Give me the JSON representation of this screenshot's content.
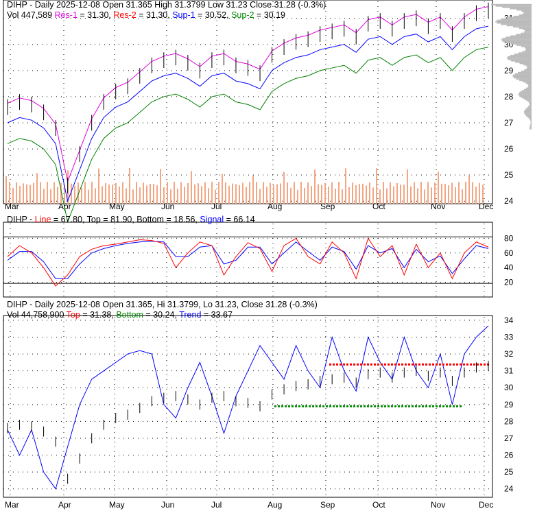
{
  "panel1": {
    "line1": "DIHP - Daily 2025-12-08 Open 31.365  High 31.3799  Low 31.23  Close 31.28 (-0.3%)",
    "vol": "Vol 447,589",
    "res1_label": "Res-1",
    "res1": "= 31.30,",
    "res2_label": "Res-2",
    "res2": "= 31.30,",
    "sup1_label": "Sup-1",
    "sup1": "= 30.52,",
    "sup2_label": "Sup-2",
    "sup2": "= 30.19"
  },
  "panel2": {
    "prefix": "DIHP -",
    "line_label": "Line",
    "line": "= 67.80,",
    "top": "Top = 81.90, Bottom = 18.56,",
    "signal_label": "Signal",
    "signal": "= 66.14"
  },
  "panel3": {
    "line1": "DIHP - Daily 2025-12-08 Open 31.365, Hi 31.3799, Lo 31.23, Close 31.28 (-0.3%)",
    "vol": "Vol 44,758,900",
    "top_label": "Top",
    "top": "= 31.38,",
    "bottom_label": "Bottom",
    "bottom": "= 30.24,",
    "trend_label": "Trend",
    "trend": "= 33.67"
  },
  "colors": {
    "res1": "#e000e0",
    "res2": "#ff0000",
    "sup1": "#0000ff",
    "sup2": "#008000",
    "volume": "#f4a582"
  },
  "chart_data": [
    {
      "type": "line",
      "title": "DIHP Daily price",
      "x": [
        "Mar",
        "Apr",
        "May",
        "Jun",
        "Jul",
        "Aug",
        "Sep",
        "Oct",
        "Nov",
        "Dec"
      ],
      "ylim": [
        24,
        31.6
      ],
      "yticks": [
        24,
        25,
        26,
        27,
        28,
        29,
        30,
        31
      ],
      "weekly_close": [
        27.6,
        27.8,
        27.7,
        27.4,
        26.8,
        24.6,
        25.8,
        27.0,
        27.8,
        28.2,
        28.4,
        28.8,
        29.2,
        29.4,
        29.5,
        29.3,
        29.0,
        29.4,
        29.5,
        29.2,
        29.1,
        28.9,
        29.6,
        29.9,
        30.1,
        30.2,
        30.4,
        30.5,
        30.6,
        30.3,
        30.8,
        30.9,
        30.6,
        30.9,
        31.0,
        30.7,
        30.9,
        30.4,
        30.9,
        31.2,
        31.3
      ]
    },
    {
      "type": "line",
      "title": "Oscillator",
      "ylim": [
        0,
        100
      ],
      "yticks": [
        20,
        40,
        60,
        80
      ],
      "series": [
        {
          "name": "Line",
          "values": [
            55,
            70,
            60,
            40,
            15,
            30,
            55,
            65,
            70,
            72,
            75,
            78,
            77,
            73,
            40,
            60,
            75,
            70,
            30,
            55,
            74,
            66,
            35,
            70,
            80,
            55,
            45,
            75,
            60,
            25,
            80,
            55,
            70,
            30,
            72,
            40,
            60,
            25,
            60,
            75,
            68
          ]
        },
        {
          "name": "Signal",
          "values": [
            50,
            62,
            62,
            48,
            25,
            25,
            45,
            60,
            66,
            70,
            73,
            75,
            76,
            75,
            55,
            55,
            68,
            70,
            45,
            50,
            68,
            68,
            45,
            60,
            75,
            62,
            50,
            68,
            62,
            38,
            70,
            60,
            66,
            40,
            65,
            48,
            56,
            32,
            52,
            70,
            66
          ]
        }
      ]
    },
    {
      "type": "line",
      "title": "Trend channel",
      "ylim": [
        23.5,
        34
      ],
      "yticks": [
        24,
        25,
        26,
        27,
        28,
        29,
        30,
        31,
        32,
        33,
        34
      ],
      "series": [
        {
          "name": "Trend",
          "values": [
            27.5,
            26.0,
            27.5,
            25.0,
            24.0,
            26.5,
            29.0,
            30.5,
            31.0,
            31.5,
            32.0,
            32.2,
            32.0,
            29.0,
            28.2,
            30.0,
            31.5,
            29.5,
            27.3,
            29.5,
            31.0,
            32.5,
            31.5,
            30.5,
            32.5,
            31.0,
            30.0,
            33.0,
            31.0,
            29.8,
            33.0,
            31.5,
            30.5,
            33.0,
            31.0,
            30.0,
            32.0,
            29.0,
            32.0,
            33.0,
            33.67
          ]
        }
      ]
    }
  ]
}
